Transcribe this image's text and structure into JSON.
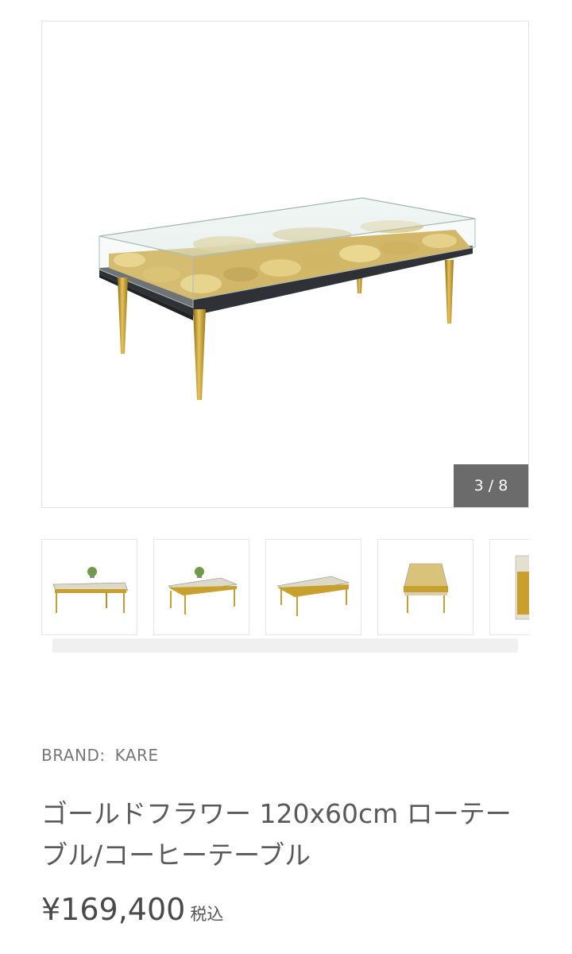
{
  "gallery": {
    "counter": "3 / 8",
    "main_image_alt": "product-photo-table",
    "thumbnails": [
      {
        "name": "thumb-1"
      },
      {
        "name": "thumb-2"
      },
      {
        "name": "thumb-3"
      },
      {
        "name": "thumb-4"
      },
      {
        "name": "thumb-5"
      }
    ]
  },
  "product": {
    "brand_label": "BRAND:",
    "brand_value": "KARE",
    "title": "ゴールドフラワー 120x60cm ローテーブル/コーヒーテーブル",
    "price": "¥169,400",
    "tax_label": "税込"
  },
  "colors": {
    "gold": "#c9a02e",
    "counter_bg": "#6b6b6b",
    "text": "#5a5a5a"
  }
}
